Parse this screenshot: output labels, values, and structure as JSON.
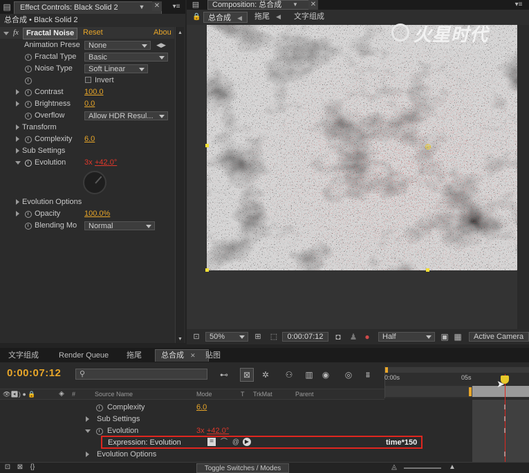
{
  "effect_panel": {
    "tab_title": "Effect Controls: Black Solid 2",
    "breadcrumb": "总合成 • Black Solid 2",
    "fx_label": "fx",
    "effect_name": "Fractal Noise",
    "reset": "Reset",
    "about": "Abou",
    "props": {
      "animation_preset": "Animation Prese",
      "animation_preset_val": "None",
      "fractal_type": "Fractal Type",
      "fractal_type_val": "Basic",
      "noise_type": "Noise Type",
      "noise_type_val": "Soft Linear",
      "invert": "Invert",
      "contrast": "Contrast",
      "contrast_val": "100.0",
      "brightness": "Brightness",
      "brightness_val": "0.0",
      "overflow": "Overflow",
      "overflow_val": "Allow HDR Resul...",
      "transform": "Transform",
      "complexity": "Complexity",
      "complexity_val": "6.0",
      "sub_settings": "Sub Settings",
      "evolution": "Evolution",
      "evolution_rev": "3x",
      "evolution_deg": "+42.0°",
      "evolution_options": "Evolution Options",
      "opacity": "Opacity",
      "opacity_val": "100.0%",
      "blending_mode": "Blending Mo",
      "blending_mode_val": "Normal"
    }
  },
  "comp_panel": {
    "tab_title": "Composition: 总合成",
    "subtabs": [
      "总合成",
      "拖尾",
      "文字组成"
    ],
    "watermark": "火星时代",
    "watermark_url": "www.hxsd.com",
    "zoom": "50%",
    "timecode": "0:00:07:12",
    "resolution": "Half",
    "camera": "Active Camera"
  },
  "timeline": {
    "tabs": [
      "文字组成",
      "Render Queue",
      "拖尾",
      "总合成",
      "贴图"
    ],
    "active_tab_index": 3,
    "timecode": "0:00:07:12",
    "search_placeholder": "",
    "columns": {
      "number": "#",
      "source_name": "Source Name",
      "mode": "Mode",
      "t": "T",
      "trkmat": "TrkMat",
      "parent": "Parent"
    },
    "ruler": {
      "start": "0:00s",
      "mid": "05s"
    },
    "layers": {
      "complexity": "Complexity",
      "complexity_val": "6.0",
      "sub_settings": "Sub Settings",
      "evolution": "Evolution",
      "evolution_rev": "3x",
      "evolution_deg": "+42.0°",
      "expression_label": "Expression: Evolution",
      "expression_code": "time*150",
      "evolution_options": "Evolution Options"
    },
    "toggle": "Toggle Switches / Modes"
  },
  "colors": {
    "accent_orange": "#e8a629",
    "keyframe_red": "#e0382b",
    "highlight_box": "#e0261f",
    "panel_bg": "#2b2b2b"
  }
}
